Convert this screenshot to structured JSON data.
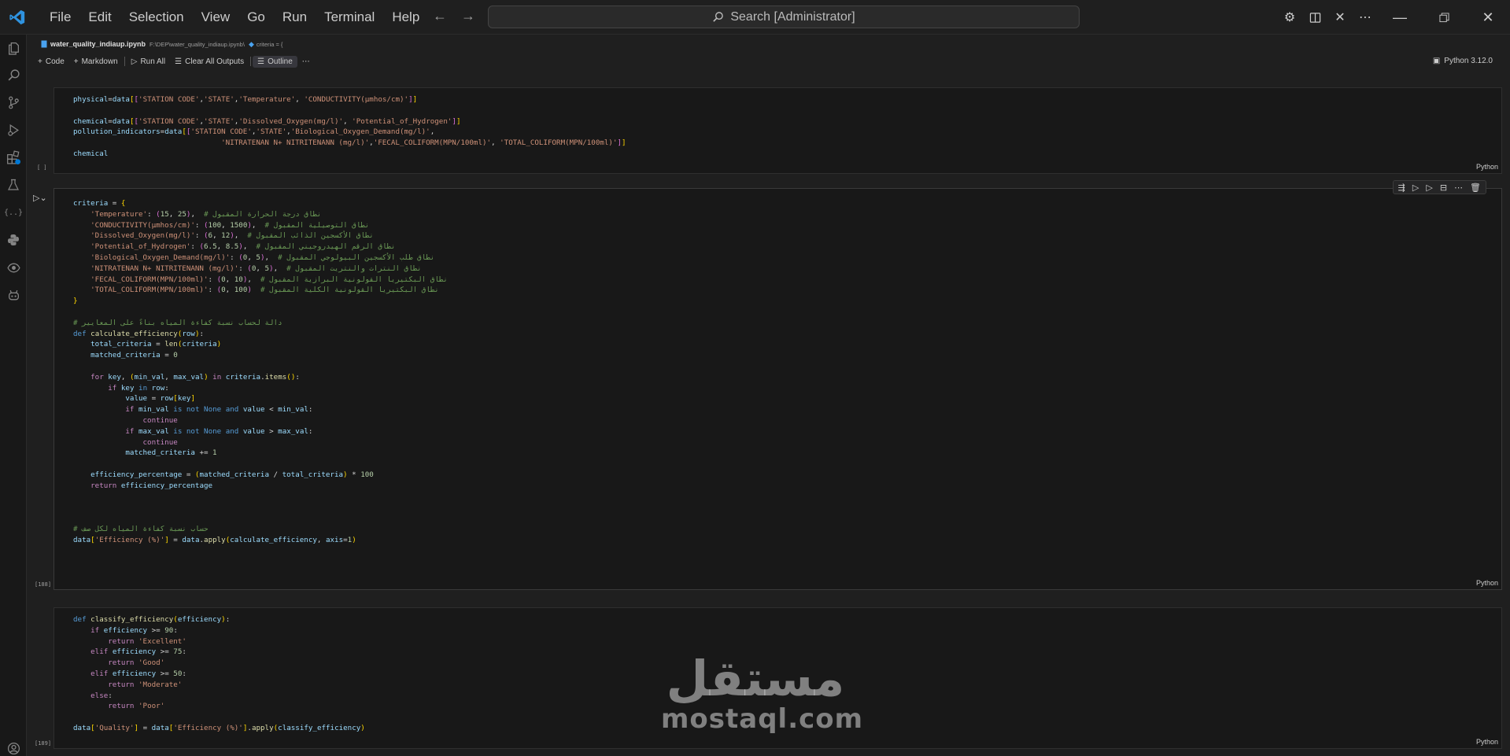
{
  "menu": [
    "File",
    "Edit",
    "Selection",
    "View",
    "Go",
    "Run",
    "Terminal",
    "Help"
  ],
  "search": {
    "label": "Search [Administrator]"
  },
  "tab": {
    "file": "water_quality_indiaup.ipynb",
    "path": "F:\\DEP\\water_quality_indiaup.ipynb\\",
    "symbol": "criteria = {"
  },
  "toolbar": {
    "code": "Code",
    "markdown": "Markdown",
    "run_all": "Run All",
    "clear_outputs": "Clear All Outputs",
    "outline": "Outline"
  },
  "kernel": "Python 3.12.0",
  "cells": [
    {
      "exec": "[ ]",
      "lang": "Python"
    },
    {
      "exec": "[188]",
      "lang": "Python"
    },
    {
      "exec": "[189]",
      "lang": "Python"
    }
  ],
  "comments": {
    "temp": "# نطاق درجة الحرارة المقبول",
    "cond": "# نطاق التوصيلية المقبول",
    "do": "# نطاق الأكسجين الذائب المقبول",
    "ph": "# نطاق الرقم الهيدروجيني المقبول",
    "bod": "# نطاق طلب الأكسجين البيولوجي المقبول",
    "nit": "# نطاق النترات والنتريت المقبول",
    "fecal": "# نطاق البكتيريا القولونية البرازية المقبول",
    "total": "# نطاق البكتيريا القولونية الكلية المقبول",
    "func": "# دالة لحساب نسبة كفاءة المياه بناءً على المعايير",
    "row": "# حساب نسبة كفاءة المياه لكل صف"
  },
  "watermark": {
    "arabic": "مستقل",
    "latin": "mostaql.com"
  },
  "colors": {
    "accent": "#0078d4",
    "background": "#1f1f1f",
    "cell": "#181818"
  }
}
